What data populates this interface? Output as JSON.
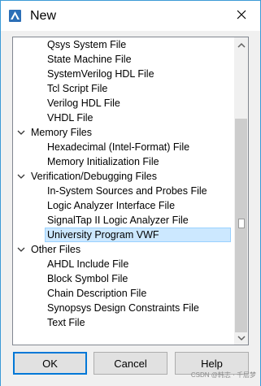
{
  "window": {
    "title": "New",
    "icon": "app-icon",
    "close_icon": "close-icon"
  },
  "tree": {
    "rows": [
      {
        "label": "Qsys System File",
        "kind": "child"
      },
      {
        "label": "State Machine File",
        "kind": "child"
      },
      {
        "label": "SystemVerilog HDL File",
        "kind": "child"
      },
      {
        "label": "Tcl Script File",
        "kind": "child"
      },
      {
        "label": "Verilog HDL File",
        "kind": "child"
      },
      {
        "label": "VHDL File",
        "kind": "child"
      },
      {
        "label": "Memory Files",
        "kind": "group"
      },
      {
        "label": "Hexadecimal (Intel-Format) File",
        "kind": "child"
      },
      {
        "label": "Memory Initialization File",
        "kind": "child"
      },
      {
        "label": "Verification/Debugging Files",
        "kind": "group"
      },
      {
        "label": "In-System Sources and Probes File",
        "kind": "child"
      },
      {
        "label": "Logic Analyzer Interface File",
        "kind": "child"
      },
      {
        "label": "SignalTap II Logic Analyzer File",
        "kind": "child"
      },
      {
        "label": "University Program VWF",
        "kind": "child",
        "selected": true
      },
      {
        "label": "Other Files",
        "kind": "group"
      },
      {
        "label": "AHDL Include File",
        "kind": "child"
      },
      {
        "label": "Block Symbol File",
        "kind": "child"
      },
      {
        "label": "Chain Description File",
        "kind": "child"
      },
      {
        "label": "Synopsys Design Constraints File",
        "kind": "child"
      },
      {
        "label": "Text File",
        "kind": "child"
      }
    ],
    "selected_color": "#cce8ff"
  },
  "buttons": {
    "ok": "OK",
    "cancel": "Cancel",
    "help": "Help"
  },
  "watermark": "CSDN @韩志 · 千层梦",
  "colors": {
    "accent": "#0078d7",
    "frame": "#3c9ad6"
  }
}
